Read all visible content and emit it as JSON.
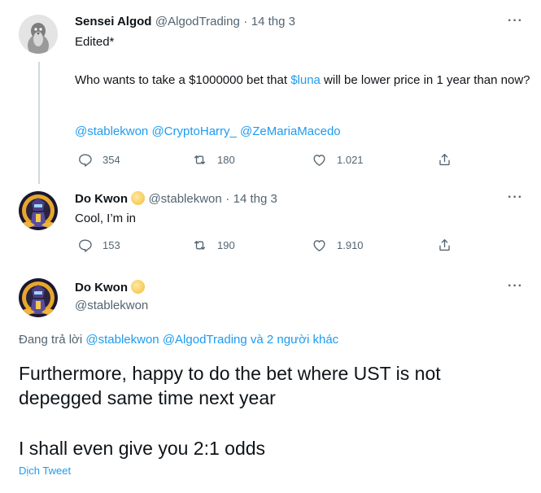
{
  "tweet1": {
    "name": "Sensei Algod",
    "handle": "@AlgodTrading",
    "sep": "·",
    "date": "14 thg 3",
    "line1": "Edited*",
    "body_pre": "Who wants to take a $1000000 bet that ",
    "body_link": "$luna",
    "body_post": " will be lower price in 1 year than now?",
    "mentions": [
      "@stablekwon",
      "@CryptoHarry_",
      "@ZeMariaMacedo"
    ],
    "replies": "354",
    "retweets": "180",
    "likes": "1.021",
    "more": "···"
  },
  "tweet2": {
    "name": "Do Kwon",
    "handle": "@stablekwon",
    "sep": "·",
    "date": "14 thg 3",
    "text": "Cool, I’m in",
    "replies": "153",
    "retweets": "190",
    "likes": "1.910",
    "more": "···"
  },
  "tweet3": {
    "name": "Do Kwon",
    "handle": "@stablekwon",
    "replying_prefix": "Đang trả lời",
    "replying_users": "@stablekwon @AlgodTrading",
    "replying_suffix": "và 2 người khác",
    "para1": "Furthermore, happy to do the bet where UST is not depegged same time next year",
    "para2": "I shall even give you 2:1 odds",
    "translate": "Dịch Tweet",
    "more": "···"
  },
  "colors": {
    "link": "#1d9bf0",
    "secondary": "#536471",
    "text": "#0f1419"
  },
  "icons": [
    "reply-icon",
    "retweet-icon",
    "like-icon",
    "share-icon",
    "more-icon",
    "moon-badge-icon"
  ]
}
